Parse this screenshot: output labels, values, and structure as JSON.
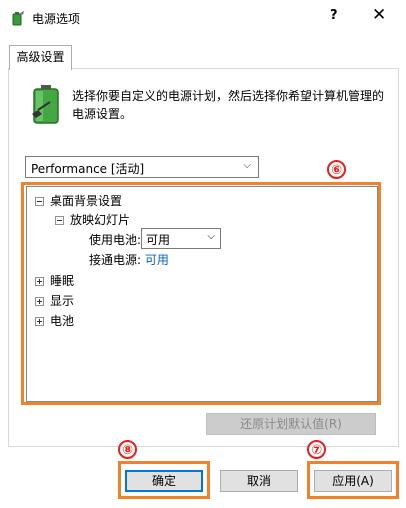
{
  "window": {
    "title": "电源选项",
    "help_label": "?",
    "close_label": "✕"
  },
  "tabs": [
    {
      "label": "高级设置"
    }
  ],
  "description": "选择你要自定义的电源计划，然后选择你希望计算机管理的电源设置。",
  "plan_select": {
    "value": "Performance [活动]"
  },
  "tree": {
    "desktop_background": "桌面背景设置",
    "slideshow": "放映幻灯片",
    "on_battery_label": "使用电池:",
    "on_battery_value": "可用",
    "plugged_in_label": "接通电源:",
    "plugged_in_value": "可用",
    "sleep": "睡眠",
    "display": "显示",
    "battery": "电池"
  },
  "buttons": {
    "restore": "还原计划默认值(R)",
    "ok": "确定",
    "cancel": "取消",
    "apply": "应用(A)"
  },
  "annotations": [
    "⑥",
    "⑦",
    "⑧"
  ],
  "colors": {
    "highlight": "#f2822a",
    "annotation_red": "#e8201a",
    "link_blue": "#0066cc",
    "focus_blue": "#0078d7"
  }
}
